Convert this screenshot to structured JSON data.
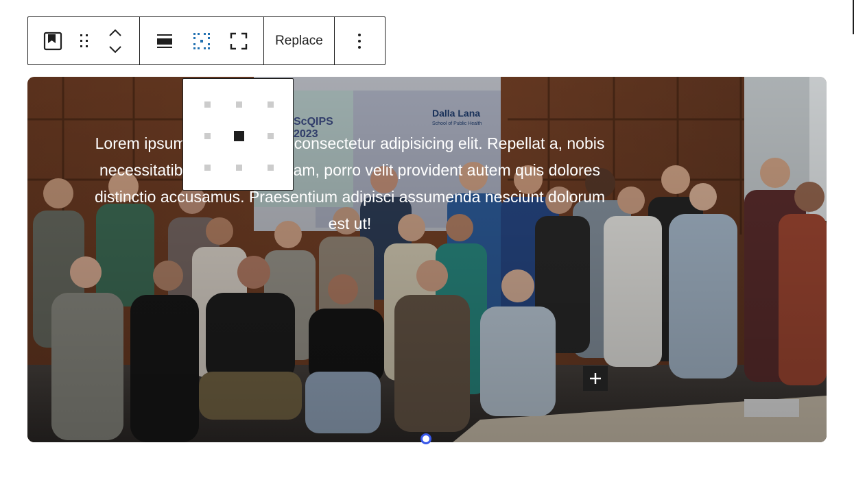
{
  "toolbar": {
    "block_type": "cover-icon",
    "drag_handle": "drag-icon",
    "move_up": "chevron-up-icon",
    "move_down": "chevron-down-icon",
    "align": "align-icon",
    "position": "position-grid-icon",
    "full_height": "fullscreen-icon",
    "replace_label": "Replace",
    "more_options": "more-vertical-icon",
    "accent_color": "#3858e9",
    "border_color": "#1e1e1e"
  },
  "position_grid": {
    "rows": 3,
    "cols": 3,
    "selected": "center center"
  },
  "cover": {
    "text": "Lorem ipsum dolor sit amet, consectetur adipisicing elit. Repellat a, nobis necessitatibus quia quibusdam, porro velit provident autem quis dolores distinctio accusamus. Praesentium adipisci assumenda nesciunt dolorum est ut!",
    "text_color": "#ffffff",
    "add_block": "plus-icon",
    "resize": "resize-handle"
  }
}
